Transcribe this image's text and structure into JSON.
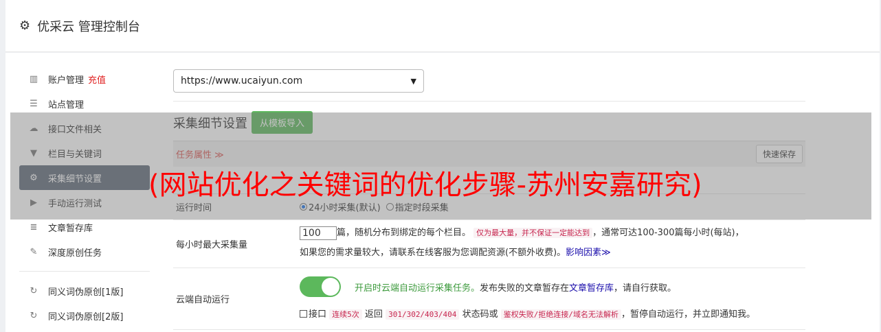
{
  "header": {
    "title": "优采云 管理控制台"
  },
  "sidebar": {
    "items": [
      {
        "icon": "bar-chart-icon",
        "glyph": "📊",
        "label": "账户管理",
        "extra": "充值"
      },
      {
        "icon": "server-icon",
        "glyph": "☰",
        "label": "站点管理"
      },
      {
        "icon": "cloud-upload-icon",
        "glyph": "☁",
        "label": "接口文件相关"
      },
      {
        "icon": "filter-icon",
        "glyph": "▼",
        "label": "栏目与关键词"
      },
      {
        "icon": "cogs-icon",
        "glyph": "⚙",
        "label": "采集细节设置"
      },
      {
        "icon": "play-circle-icon",
        "glyph": "▶",
        "label": "手动运行测试"
      },
      {
        "icon": "database-icon",
        "glyph": "≣",
        "label": "文章暂存库"
      },
      {
        "icon": "edit-icon",
        "glyph": "✎",
        "label": "深度原创任务"
      },
      {
        "icon": "refresh-icon",
        "glyph": "↻",
        "label": "同义词伪原创[1版]"
      },
      {
        "icon": "refresh-icon",
        "glyph": "↻",
        "label": "同义词伪原创[2版]"
      }
    ]
  },
  "content": {
    "site_select": "https://www.ucaiyun.com",
    "section_title": "采集细节设置",
    "import_button": "从模板导入",
    "attr_label": "任务属性 ≫",
    "quick_save": "快速保存",
    "runtime": {
      "label": "运行时间",
      "opt1": "24小时采集(默认)",
      "opt2": "指定时段采集"
    },
    "max_per_hour": {
      "label": "每小时最大采集量",
      "value": "100",
      "text1": "篇，随机分布到绑定的每个栏目。",
      "code1": "仅为最大量，并不保证一定能达到",
      "text2": "，通常可达100-300篇每小时(每站)，",
      "text3": "如果您的需求量较大，请联系在线客服为您调配资源(不额外收费)。",
      "link": "影响因素≫"
    },
    "cloud_run": {
      "label": "云端自动运行",
      "enabled_text": "开启时云端自动运行采集任务。",
      "text1": "发布失败的文章暂存在",
      "link": "文章暂存库",
      "text2": "，请自行获取。",
      "chk_prefix": "接口",
      "code_a": "连续5次",
      "text_b": "返回",
      "code_c": "301/302/403/404",
      "text_d": "状态码或",
      "code_e": "鉴权失败/拒绝连接/域名无法解析",
      "text_f": "，暂停自动运行，并立即通知我。"
    }
  },
  "overlay_title": "(网站优化之关键词的优化步骤-苏州安嘉研究)"
}
